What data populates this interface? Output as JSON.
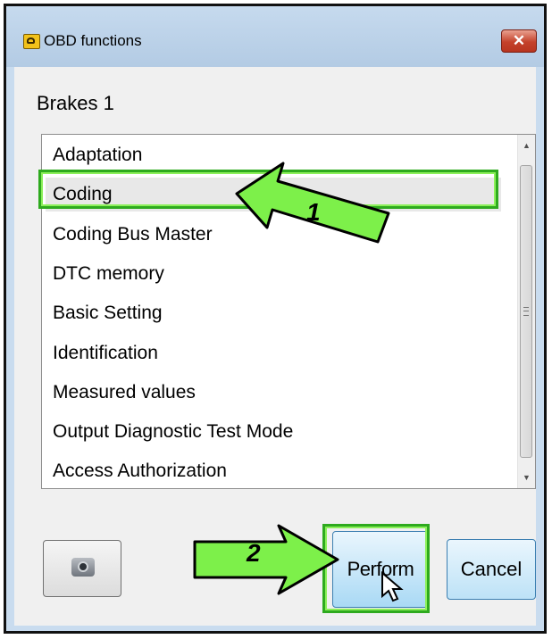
{
  "window": {
    "title": "OBD functions",
    "close_glyph": "✕",
    "icon": "obd-app-icon"
  },
  "module": {
    "label": "Brakes 1"
  },
  "functions_list": {
    "items": [
      {
        "label": "Adaptation",
        "selected": false
      },
      {
        "label": "Coding",
        "selected": true
      },
      {
        "label": "Coding Bus Master",
        "selected": false
      },
      {
        "label": "DTC memory",
        "selected": false
      },
      {
        "label": "Basic Setting",
        "selected": false
      },
      {
        "label": "Identification",
        "selected": false
      },
      {
        "label": "Measured values",
        "selected": false
      },
      {
        "label": "Output Diagnostic Test Mode",
        "selected": false
      },
      {
        "label": "Access Authorization",
        "selected": false
      }
    ],
    "scroll_up_glyph": "▲",
    "scroll_down_glyph": "▼"
  },
  "buttons": {
    "camera_icon": "camera-icon",
    "perform_label": "Perform",
    "cancel_label": "Cancel"
  },
  "annotations": {
    "callout_1": "1",
    "callout_2": "2",
    "highlight_color": "#2eaa1e",
    "arrow_color": "#7df04a"
  },
  "colors": {
    "titlebar": "#c6daee",
    "close_button": "#c4412a",
    "accent_button": "#a9d9f5"
  }
}
